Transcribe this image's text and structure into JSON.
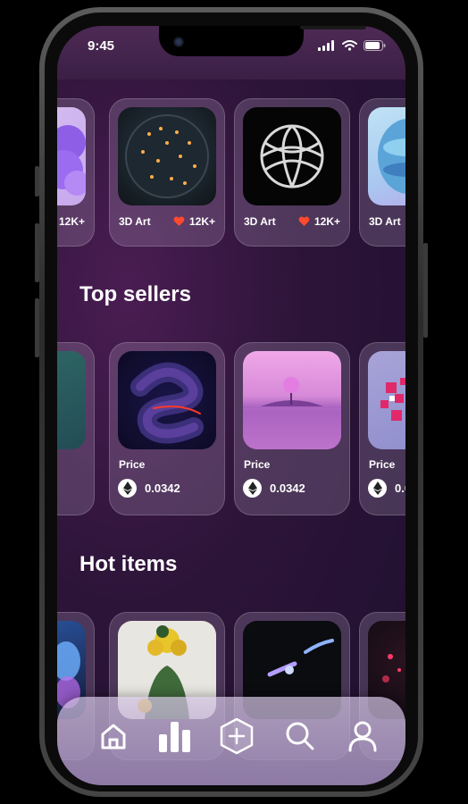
{
  "status_bar": {
    "time": "9:45"
  },
  "row_one": {
    "cards": [
      {
        "category": "",
        "likes": "12K+"
      },
      {
        "category": "3D Art",
        "likes": "12K+"
      },
      {
        "category": "3D Art",
        "likes": "12K+"
      },
      {
        "category": "3D Art",
        "likes": ""
      }
    ]
  },
  "top_sellers": {
    "title": "Top sellers",
    "cards": [
      {
        "price_label": "",
        "price": ""
      },
      {
        "price_label": "Price",
        "price": "0.0342"
      },
      {
        "price_label": "Price",
        "price": "0.0342"
      },
      {
        "price_label": "Price",
        "price": "0.0"
      }
    ]
  },
  "hot_items": {
    "title": "Hot items"
  },
  "bottom_nav": {
    "items": [
      {
        "icon": "home-icon"
      },
      {
        "icon": "stats-icon"
      },
      {
        "icon": "add-icon"
      },
      {
        "icon": "search-icon"
      },
      {
        "icon": "profile-icon"
      }
    ]
  },
  "colors": {
    "heart": "#ff4a2e",
    "accent": "#3b1f45"
  }
}
